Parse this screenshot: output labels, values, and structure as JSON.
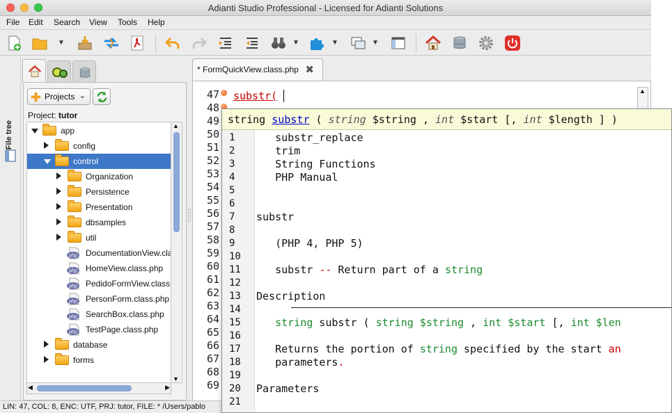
{
  "window": {
    "title": "Adianti Studio Professional - Licensed for Adianti Solutions"
  },
  "menu": [
    "File",
    "Edit",
    "Search",
    "View",
    "Tools",
    "Help"
  ],
  "sidebar": {
    "vertical_label": "File tree"
  },
  "project": {
    "button_label": "Projects",
    "label_prefix": "Project:",
    "name": "tutor"
  },
  "tree": [
    {
      "label": "app",
      "depth": 0,
      "type": "folder",
      "state": "expanded"
    },
    {
      "label": "config",
      "depth": 1,
      "type": "folder",
      "state": "collapsed"
    },
    {
      "label": "control",
      "depth": 1,
      "type": "folder",
      "state": "expanded",
      "selected": true
    },
    {
      "label": "Organization",
      "depth": 2,
      "type": "folder",
      "state": "collapsed"
    },
    {
      "label": "Persistence",
      "depth": 2,
      "type": "folder",
      "state": "collapsed"
    },
    {
      "label": "Presentation",
      "depth": 2,
      "type": "folder",
      "state": "collapsed"
    },
    {
      "label": "dbsamples",
      "depth": 2,
      "type": "folder",
      "state": "collapsed"
    },
    {
      "label": "util",
      "depth": 2,
      "type": "folder",
      "state": "collapsed"
    },
    {
      "label": "DocumentationView.cla",
      "depth": 2,
      "type": "php"
    },
    {
      "label": "HomeView.class.php",
      "depth": 2,
      "type": "php"
    },
    {
      "label": "PedidoFormView.class.",
      "depth": 2,
      "type": "php"
    },
    {
      "label": "PersonForm.class.php",
      "depth": 2,
      "type": "php"
    },
    {
      "label": "SearchBox.class.php",
      "depth": 2,
      "type": "php"
    },
    {
      "label": "TestPage.class.php",
      "depth": 2,
      "type": "php"
    },
    {
      "label": "database",
      "depth": 1,
      "type": "folder",
      "state": "collapsed"
    },
    {
      "label": "forms",
      "depth": 1,
      "type": "folder",
      "state": "collapsed"
    }
  ],
  "editor": {
    "tab_label": "* FormQuickView.class.php",
    "line_numbers": [
      "47",
      "48",
      "49",
      "50",
      "51",
      "52",
      "53",
      "54",
      "55",
      "56",
      "57",
      "58",
      "59",
      "60",
      "61",
      "62",
      "63",
      "64",
      "65",
      "66",
      "67",
      "68",
      "69"
    ],
    "current_line_text": "substr(",
    "php_badge": "php"
  },
  "popup": {
    "signature": {
      "ret": "string",
      "name": "substr",
      "p1": "(",
      "t1": "string",
      "a1": "$string ,",
      "t2": "int",
      "a2": "$start [,",
      "t3": "int",
      "a3": "$length ] )"
    },
    "lines": [
      {
        "n": "1",
        "text": "   substr_replace"
      },
      {
        "n": "2",
        "text": "   trim"
      },
      {
        "n": "3",
        "text": "   String Functions"
      },
      {
        "n": "4",
        "text": "   PHP Manual"
      },
      {
        "n": "5",
        "text": ""
      },
      {
        "n": "6",
        "text": ""
      },
      {
        "n": "7",
        "text": "substr"
      },
      {
        "n": "8",
        "text": ""
      },
      {
        "n": "9",
        "text": "   (PHP 4, PHP 5)"
      },
      {
        "n": "10",
        "text": ""
      },
      {
        "n": "11",
        "parts": [
          {
            "t": "   substr "
          },
          {
            "t": "--",
            "c": "op"
          },
          {
            "t": " Return part of a "
          },
          {
            "t": "string",
            "c": "kw"
          }
        ]
      },
      {
        "n": "12",
        "text": ""
      },
      {
        "n": "13",
        "text": "Description"
      },
      {
        "n": "14",
        "text": ""
      },
      {
        "n": "15",
        "parts": [
          {
            "t": "   "
          },
          {
            "t": "string",
            "c": "kw"
          },
          {
            "t": " substr ( "
          },
          {
            "t": "string $string",
            "c": "kw"
          },
          {
            "t": " , "
          },
          {
            "t": "int $start",
            "c": "kw"
          },
          {
            "t": " [, "
          },
          {
            "t": "int $len",
            "c": "kw"
          }
        ]
      },
      {
        "n": "16",
        "text": ""
      },
      {
        "n": "17",
        "parts": [
          {
            "t": "   Returns the portion of "
          },
          {
            "t": "string",
            "c": "kw"
          },
          {
            "t": " specified by the start "
          },
          {
            "t": "an",
            "c": "op"
          }
        ]
      },
      {
        "n": "18",
        "parts": [
          {
            "t": "   parameters"
          },
          {
            "t": ".",
            "c": "op"
          }
        ]
      },
      {
        "n": "19",
        "text": ""
      },
      {
        "n": "20",
        "text": "Parameters"
      },
      {
        "n": "21",
        "text": ""
      }
    ]
  },
  "status": {
    "text": "LIN: 47, COL: 8, ENC: UTF, PRJ: tutor, FILE: * /Users/pablo"
  },
  "colors": {
    "selection": "#3e78c8",
    "keyword": "#1a8a2e",
    "function_name": "#0000cc",
    "error": "#cc0000"
  }
}
